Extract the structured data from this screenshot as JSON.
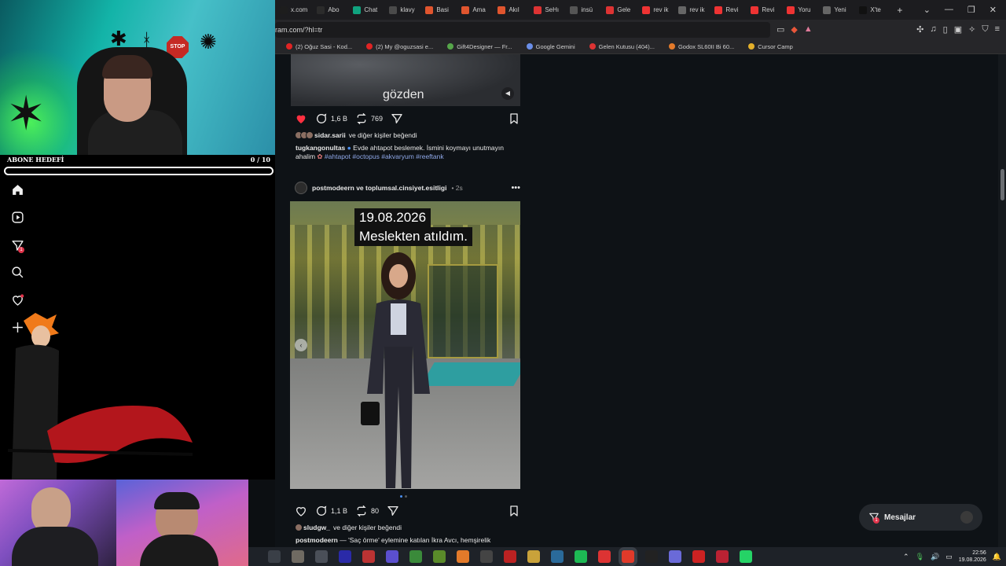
{
  "browser": {
    "tabs": [
      {
        "label": "x.com",
        "color": "#1d1d1d"
      },
      {
        "label": "Abo",
        "color": "#2b2b2b"
      },
      {
        "label": "Chat",
        "color": "#10a37f"
      },
      {
        "label": "klavy",
        "color": "#4a4a4a"
      },
      {
        "label": "Basi",
        "color": "#e0552e"
      },
      {
        "label": "Ama",
        "color": "#e0552e"
      },
      {
        "label": "Akıl",
        "color": "#e0552e"
      },
      {
        "label": "SeHı",
        "color": "#d33"
      },
      {
        "label": "insü",
        "color": "#555"
      },
      {
        "label": "Gele",
        "color": "#d33"
      },
      {
        "label": "rev ik",
        "color": "#e33"
      },
      {
        "label": "rev ik",
        "color": "#666"
      },
      {
        "label": "Revi",
        "color": "#e33"
      },
      {
        "label": "Revi",
        "color": "#e33"
      },
      {
        "label": "Yoru",
        "color": "#e33"
      },
      {
        "label": "Yeni",
        "color": "#666"
      },
      {
        "label": "X'te",
        "color": "#111"
      }
    ],
    "new_tab": "+",
    "url": "ram.com/?hl=tr",
    "bookmarks": [
      {
        "label": "(2) Oğuz Sasi - Kod...",
        "color": "#e02424"
      },
      {
        "label": "(2) My @oguzsasi e...",
        "color": "#e02424"
      },
      {
        "label": "Gift4Designer — Fr...",
        "color": "#56a64a"
      },
      {
        "label": "Google Gemini",
        "color": "#6a8ee8"
      },
      {
        "label": "Gelen Kutusu (404)...",
        "color": "#d33"
      },
      {
        "label": "Godox SL60II Bi 60...",
        "color": "#e37a2a"
      },
      {
        "label": "Cursor Camp",
        "color": "#e3b02a"
      }
    ]
  },
  "post1": {
    "media_caption": "gözden",
    "likes": "1,6 B",
    "reposts": "769",
    "liked_by_user": "sidar.sarii",
    "liked_by_suffix": "ve diğer kişiler beğendi",
    "author": "tugkangonultas",
    "caption": "Evde ahtapot beslemek. İsmini koymayı unutmayın ahalim",
    "hashtags": "#ahtapot #octopus #akvaryum #reeftank"
  },
  "post2": {
    "authors": "postmodeern ve toplumsal.cinsiyet.esitligi",
    "time": "• 2s",
    "overlay_line1": "19.08.2026",
    "overlay_line2": "Meslekten atıldım.",
    "likes": "1,1 B",
    "reposts": "80",
    "liked_by_user": "sludgw_",
    "liked_by_suffix": "ve diğer kişiler beğendi",
    "author": "postmodeern",
    "caption": "— 'Saç örme' eylemine katılan İkra Avcı, hemşirelik"
  },
  "messages": {
    "label": "Mesajlar",
    "badge": "1"
  },
  "overlay": {
    "goal_label": "ABONE HEDEFİ",
    "goal_count": "0 / 10",
    "goal_progress": 0,
    "stop_sign": "STOP"
  },
  "rail": {
    "notification_badge": "1"
  },
  "taskbar": {
    "apps": [
      "#3a3f47",
      "#6f6a62",
      "#4a4f58",
      "#2a2aa8",
      "#b33",
      "#5b4fcf",
      "#3a8a3a",
      "#5a8a2a",
      "#e37a2a",
      "#444",
      "#b22",
      "#c9a23a",
      "#2a6a9a",
      "#1db954",
      "#d33",
      "#e03a2a",
      "#222",
      "#6a6ad8",
      "#c22",
      "#b23",
      "#25d366"
    ],
    "time": "22:56",
    "date": "19.08.2026"
  },
  "colors": {
    "accent_heart": "#ff3040",
    "link": "#8fa8e8",
    "badge": "#e0334a"
  }
}
